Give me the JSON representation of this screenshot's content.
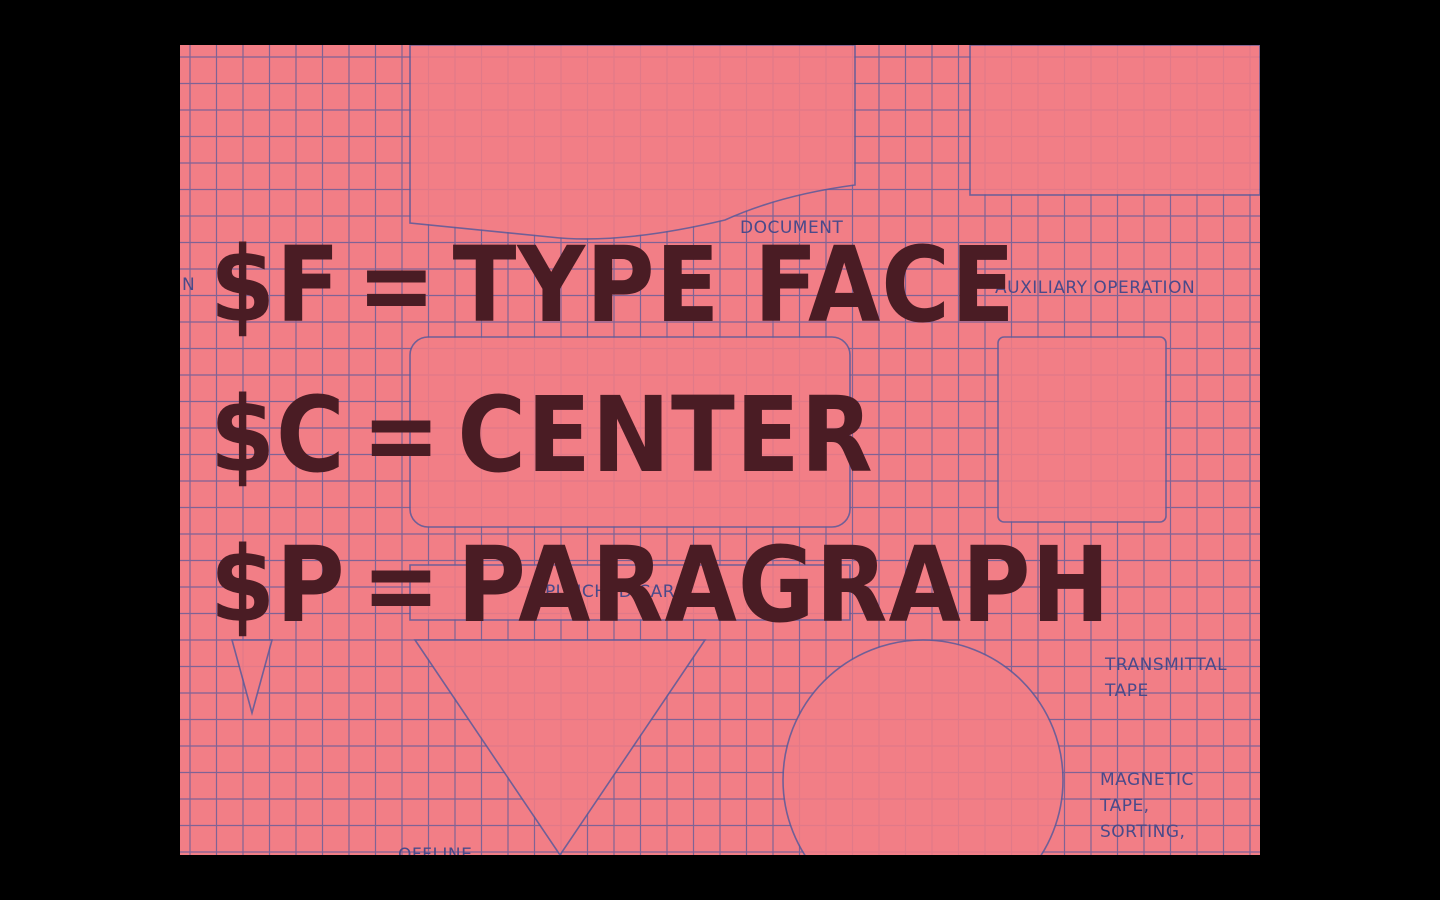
{
  "colors": {
    "letterbox": "#000000",
    "card_background": "#f27e86",
    "grid_lines": "#5a5a9a",
    "mnemonic_text": "#4a1c24"
  },
  "mnemonics": [
    {
      "code": "$F",
      "equals": "=",
      "meaning": "TYPE FACE"
    },
    {
      "code": "$C",
      "equals": "=",
      "meaning": "CENTER"
    },
    {
      "code": "$P",
      "equals": "=",
      "meaning": "PARAGRAPH"
    }
  ],
  "background_labels": {
    "document": "DOCUMENT",
    "auxiliary_operation": "AUXILIARY OPERATION",
    "left_fragment": "N",
    "punched_card": "PUNCHED CARD",
    "transmittal_tape_1": "TRANSMITTAL",
    "transmittal_tape_2": "TAPE",
    "magnetic_tape_1": "MAGNETIC",
    "magnetic_tape_2": "TAPE,",
    "magnetic_tape_3": "SORTING,",
    "offline": "OFFLINE"
  }
}
